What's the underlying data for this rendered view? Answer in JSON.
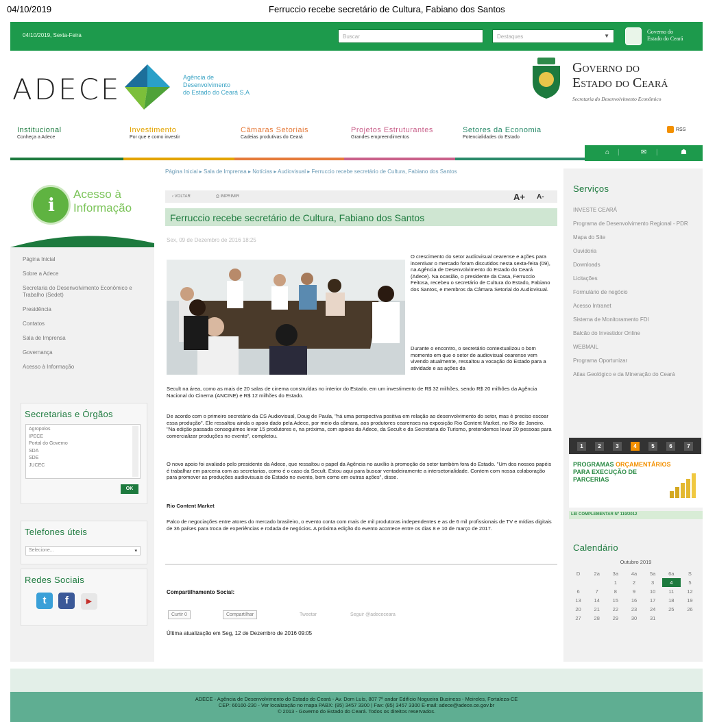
{
  "print_header": {
    "date": "04/10/2019",
    "title": "Ferruccio recebe secretário de Cultura, Fabiano dos Santos"
  },
  "topbar": {
    "date": "04/10/2019, Sexta-Feira",
    "search_placeholder": "Buscar",
    "highlights_placeholder": "Destaques",
    "gov_label_line1": "Governo do",
    "gov_label_line2": "Estado do Ceará"
  },
  "header": {
    "brand": "ADECE",
    "agency_line1": "Agência de",
    "agency_line2": "Desenvolvimento",
    "agency_line3": "do Estado do Ceará S.A",
    "gov_line1": "Governo do",
    "gov_line2": "Estado do Ceará",
    "gov_sub": "Secretaria do Desenvolvimento Econômico"
  },
  "nav": {
    "items": [
      {
        "title": "Institucional",
        "sub": "Conheça a Adece",
        "color": "#1d7a3e"
      },
      {
        "title": "Investimento",
        "sub": "Por que e como investir",
        "color": "#e3a400"
      },
      {
        "title": "Câmaras Setoriais",
        "sub": "Cadeias produtivas do Ceará",
        "color": "#e57a3a"
      },
      {
        "title": "Projetos Estruturantes",
        "sub": "Grandes empreendimentos",
        "color": "#c9608a"
      },
      {
        "title": "Setores da Economia",
        "sub": "Potencialidades do Estado",
        "color": "#2a8a6a"
      }
    ],
    "rss": "RSS"
  },
  "left": {
    "acesso_line1": "Acesso à",
    "acesso_line2": "Informação",
    "menu": [
      "Página Inicial",
      "Sobre a Adece",
      "Secretaria do Desenvolvimento Econômico e Trabalho (Sedet)",
      "Presidência",
      "Contatos",
      "Sala de Imprensa",
      "Governança",
      "Acesso à Informação"
    ],
    "secretarias_title": "Secretarias e Órgãos",
    "secretarias_list": [
      "Agropolos",
      "IPECE",
      "Portal do Governo",
      "SDA",
      "SDE",
      "JUCEC"
    ],
    "ok": "OK",
    "telefones_title": "Telefones úteis",
    "telefones_select": "Selecione...",
    "redes_title": "Redes Sociais"
  },
  "main": {
    "breadcrumb": "Página Inicial ▸ Sala de Imprensa ▸ Notícias ▸ Audiovisual ▸ Ferruccio recebe secretário de Cultura, Fabiano dos Santos",
    "back": "‹ VOLTAR",
    "print": "IMPRIMIR",
    "font_up": "A+",
    "font_down": "A-",
    "title": "Ferruccio recebe secretário de Cultura, Fabiano dos Santos",
    "date": "Sex, 09 de Dezembro de 2016 18:25",
    "p1": "O crescimento do setor audiovisual cearense e ações para incentivar o mercado foram discutidos nesta sexta-feira (09), na Agência de Desenvolvimento do Estado do Ceará (Adece). Na ocasião, o presidente da Casa, Ferruccio Feitosa, recebeu o secretário de Cultura do Estado, Fabiano dos Santos, e membros da Câmara Setorial do Audiovisual.",
    "p2_top": "Durante o encontro, o secretário contextualizou o bom momento em que o setor de audiovisual cearense vem vivendo atualmente, ressaltou a vocação do Estado para a atividade e as ações da",
    "p2_rest": "Secult na área, como as mais de 20 salas de cinema construídas no interior do Estado, em um investimento de R$ 32 milhões, sendo R$ 20 milhões da Agência Nacional do Cinema (ANCINE) e R$ 12 milhões do Estado.",
    "p3": "De acordo com o primeiro secretário da CS Audiovisual, Doug de Paula, \"há uma perspectiva positiva em relação ao desenvolvimento do setor, mas é preciso escoar essa produção\". Ele ressaltou ainda o apoio dado pela Adece, por meio da câmara, aos produtores cearenses na exposição Rio Content Market, no Rio de Janeiro. \"Na edição passada conseguimos levar 15 produtores e, na próxima, com apoios da Adece, da Secult e da Secretaria do Turismo, pretendemos levar 20 pessoas para comercializar produções no evento\", completou.",
    "p4": "O novo apoio foi avaliado pelo presidente da Adece, que ressaltou o papel da Agência no auxílio à promoção do setor também fora do Estado. \"Um dos nossos papéis é trabalhar em parceria com as secretarias, como é o caso da Secult. Estou aqui para buscar ventadeiramente a intersetorialidade. Contem com nossa colaboração para promover as produções audiovisuais do Estado no evento, bem como em outras ações\", disse.",
    "sub": "Rio Content Market",
    "p5": "Palco de negociações entre atores do mercado brasileiro, o evento conta com mais de mil produtoras independentes e as de 6 mil profissionais de TV e mídias digitais de 36 países para troca de experiências e rodada de negócios. A próxima edição do evento acontece entre os dias 8 e 10 de março de 2017.",
    "share_title": "Compartilhamento Social:",
    "curtir": "Curtir 0",
    "compartilhar": "Compartilhar",
    "tweetar": "Tweetar",
    "seguir": "Seguir @adececeara",
    "updated": "Última atualização em Seg, 12 de Dezembro de 2016 09:05"
  },
  "right": {
    "servicos_title": "Serviços",
    "servicos": [
      "INVESTE CEARÁ",
      "Programa de Desenvolvimento Regional - PDR",
      "Mapa do Site",
      "Ouvidoria",
      "Downloads",
      "Licitações",
      "Formulário de negócio",
      "Acesso Intranet",
      "Sistema de Monitoramento FDI",
      "Balcão do Investidor Online",
      "WEBMAIL",
      "Programa Oportunizar",
      "Atlas Geológico e da Mineração do Ceará"
    ],
    "pager": [
      "1",
      "2",
      "3",
      "4",
      "5",
      "6",
      "7"
    ],
    "pager_active": "4",
    "banner_l1a": "PROGRAMAS ",
    "banner_l1b": "ORÇAMENTÁRIOS",
    "banner_l2": "PARA EXECUÇÃO DE",
    "banner_l3": "PARCERIAS",
    "lei": "LEI COMPLEMENTAR Nº 119/2012",
    "calendario_title": "Calendário",
    "cal_month": "Outubro 2019",
    "cal_head": [
      "D",
      "2a",
      "3a",
      "4a",
      "5a",
      "6a",
      "S"
    ],
    "cal_rows": [
      [
        "",
        "",
        "1",
        "2",
        "3",
        "4",
        "5"
      ],
      [
        "6",
        "7",
        "8",
        "9",
        "10",
        "11",
        "12"
      ],
      [
        "13",
        "14",
        "15",
        "16",
        "17",
        "18",
        "19"
      ],
      [
        "20",
        "21",
        "22",
        "23",
        "24",
        "25",
        "26"
      ],
      [
        "27",
        "28",
        "29",
        "30",
        "31",
        "",
        ""
      ]
    ],
    "cal_today": "4"
  },
  "footer": {
    "line1": "ADECE - Agência de Desenvolvimento do Estado do Ceará - Av. Dom Luís, 807 7º andar Edifício Nogueira Business - Meireles, Fortaleza-CE",
    "line2": "CEP: 60160-230 - Ver localização no mapa PABX: (85) 3457 3300 | Fax: (85) 3457 3300 E-mail: adece@adece.ce.gov.br",
    "line3": "© 2013 - Governo do Estado do Ceará. Todos os direitos reservados."
  },
  "colors": {
    "green": "#1d9a4c",
    "dark_green": "#1d7a3e",
    "light_green_bar": "#cfe6d2",
    "orange": "#f39000",
    "footer": "#5fae92"
  }
}
